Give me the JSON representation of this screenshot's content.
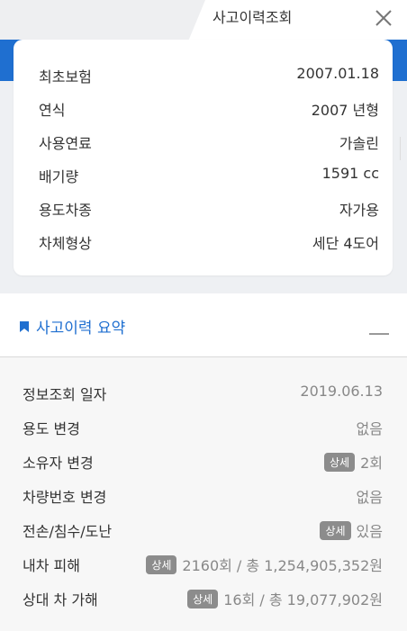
{
  "header": {
    "title": "사고이력조회"
  },
  "info": [
    {
      "label": "최초보험",
      "value": "2007.01.18"
    },
    {
      "label": "연식",
      "value": "2007 년형"
    },
    {
      "label": "사용연료",
      "value": "가솔린"
    },
    {
      "label": "배기량",
      "value": "1591 cc"
    },
    {
      "label": "용도차종",
      "value": "자가용"
    },
    {
      "label": "차체형상",
      "value": "세단 4도어"
    }
  ],
  "summary": {
    "title": "사고이력 요약",
    "badge_label": "상세",
    "rows": [
      {
        "label": "정보조회 일자",
        "value": "2019.06.13"
      },
      {
        "label": "용도 변경",
        "value": "없음"
      },
      {
        "label": "소유자 변경",
        "value": "2회"
      },
      {
        "label": "차량번호 변경",
        "value": "없음"
      },
      {
        "label": "전손/침수/도난",
        "value": "있음"
      },
      {
        "label": "내차 피해",
        "value": "2160회 / 총 1,254,905,352원"
      },
      {
        "label": "상대 차 가해",
        "value": "16회 / 총 19,077,902원"
      }
    ]
  },
  "colors": {
    "accent": "#1f6fd0",
    "badge": "#8c8c8c",
    "panel_bg": "#eef0f3"
  }
}
